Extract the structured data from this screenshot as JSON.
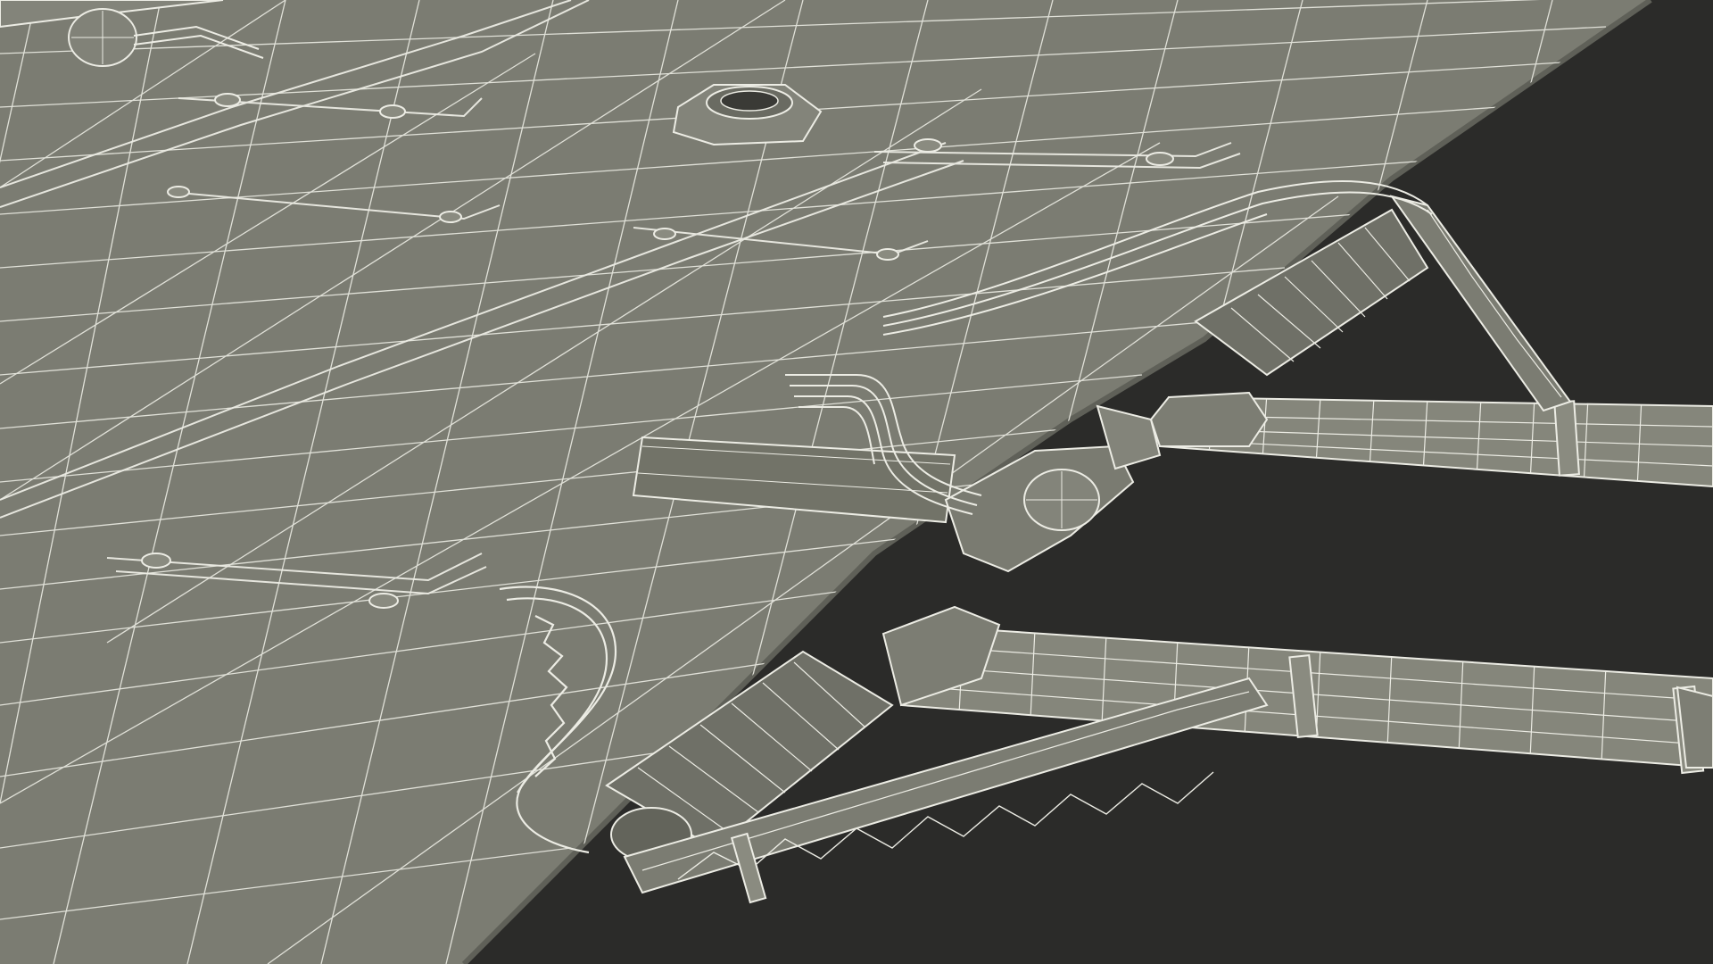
{
  "scene": {
    "colors": {
      "background": "#2b2b29",
      "surface": "#7b7c72",
      "surface_shadow": "#5f6058",
      "wire": "#ecece4",
      "wire_dim": "#c9c9bf",
      "accent_dark": "#3a3a36"
    },
    "icons": {
      "grommet": "grommet-icon",
      "handle": "handle-icon",
      "strap": "strap-icon"
    }
  }
}
